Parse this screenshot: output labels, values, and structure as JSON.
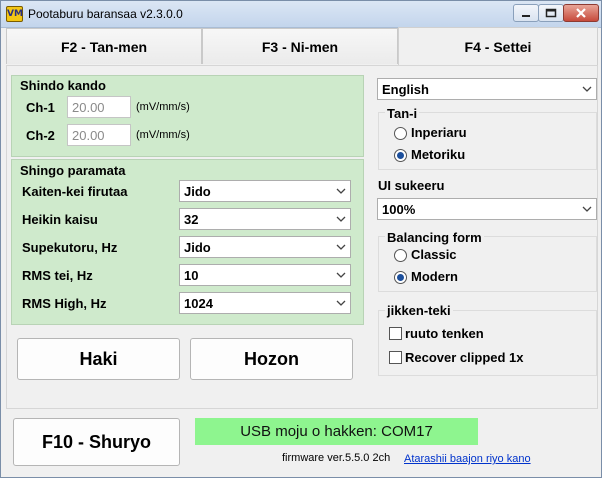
{
  "window": {
    "title": "Pootaburu baransaa v2.3.0.0",
    "icon_letters": "VM"
  },
  "tabs": [
    {
      "label": "F2 - Tan-men",
      "selected": false
    },
    {
      "label": "F3 - Ni-men",
      "selected": false
    },
    {
      "label": "F4 - Settei",
      "selected": true
    }
  ],
  "sensitivity": {
    "title": "Shindo kando",
    "ch1": {
      "label": "Ch-1",
      "value": "20.00",
      "unit": "(mV/mm/s)"
    },
    "ch2": {
      "label": "Ch-2",
      "value": "20.00",
      "unit": "(mV/mm/s)"
    }
  },
  "signal": {
    "title": "Shingo paramata",
    "rows": [
      {
        "label": "Kaiten-kei firutaa",
        "value": "Jido"
      },
      {
        "label": "Heikin kaisu",
        "value": "32"
      },
      {
        "label": "Supekutoru, Hz",
        "value": "Jido"
      },
      {
        "label": "RMS tei, Hz",
        "value": "10"
      },
      {
        "label": "RMS High, Hz",
        "value": "1024"
      }
    ]
  },
  "buttons": {
    "discard": "Haki",
    "save": "Hozon",
    "exit": "F10 - Shuryo"
  },
  "language": {
    "value": "English"
  },
  "units": {
    "title": "Tan-i",
    "options": [
      "Inperiaru",
      "Metoriku"
    ],
    "selected": "Metoriku"
  },
  "ui_scale": {
    "label": "UI sukeeru",
    "value": "100%"
  },
  "balancing_form": {
    "title": "Balancing form",
    "options": [
      "Classic",
      "Modern"
    ],
    "selected": "Modern"
  },
  "experimental": {
    "title": "jikken-teki",
    "options": [
      {
        "label": "ruuto tenken",
        "checked": false
      },
      {
        "label": "Recover clipped 1x",
        "checked": false
      }
    ]
  },
  "status": {
    "text": "USB moju o hakken: COM17",
    "color": "#8ef58f"
  },
  "footer": {
    "firmware": "firmware ver.5.5.0 2ch",
    "link": "Atarashii baajon riyo kano"
  }
}
